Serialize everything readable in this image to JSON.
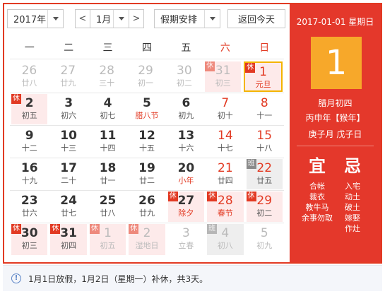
{
  "toolbar": {
    "year": "2017年",
    "prev_arrow": "<",
    "month": "1月",
    "next_arrow": ">",
    "holiday": "假期安排",
    "today": "返回今天"
  },
  "weekdays": [
    "一",
    "二",
    "三",
    "四",
    "五",
    "六",
    "日"
  ],
  "weeks": [
    [
      {
        "day": "26",
        "lunar": "廿八",
        "other": true
      },
      {
        "day": "27",
        "lunar": "廿九",
        "other": true
      },
      {
        "day": "28",
        "lunar": "三十",
        "other": true
      },
      {
        "day": "29",
        "lunar": "初一",
        "other": true
      },
      {
        "day": "30",
        "lunar": "初二",
        "other": true
      },
      {
        "day": "31",
        "lunar": "初三",
        "other": true,
        "badge": "休"
      },
      {
        "day": "1",
        "lunar": "元旦",
        "badge": "休",
        "festival": true,
        "selected": true
      }
    ],
    [
      {
        "day": "2",
        "lunar": "初五",
        "badge": "休"
      },
      {
        "day": "3",
        "lunar": "初六"
      },
      {
        "day": "4",
        "lunar": "初七"
      },
      {
        "day": "5",
        "lunar": "腊八节",
        "festival": true
      },
      {
        "day": "6",
        "lunar": "初九"
      },
      {
        "day": "7",
        "lunar": "初十"
      },
      {
        "day": "8",
        "lunar": "十一"
      }
    ],
    [
      {
        "day": "9",
        "lunar": "十二"
      },
      {
        "day": "10",
        "lunar": "十三"
      },
      {
        "day": "11",
        "lunar": "十四"
      },
      {
        "day": "12",
        "lunar": "十五"
      },
      {
        "day": "13",
        "lunar": "十六"
      },
      {
        "day": "14",
        "lunar": "十七"
      },
      {
        "day": "15",
        "lunar": "十八"
      }
    ],
    [
      {
        "day": "16",
        "lunar": "十九"
      },
      {
        "day": "17",
        "lunar": "二十"
      },
      {
        "day": "18",
        "lunar": "廿一"
      },
      {
        "day": "19",
        "lunar": "廿二"
      },
      {
        "day": "20",
        "lunar": "小年",
        "festival": true
      },
      {
        "day": "21",
        "lunar": "廿四"
      },
      {
        "day": "22",
        "lunar": "廿五",
        "badge": "班"
      }
    ],
    [
      {
        "day": "23",
        "lunar": "廿六"
      },
      {
        "day": "24",
        "lunar": "廿七"
      },
      {
        "day": "25",
        "lunar": "廿八"
      },
      {
        "day": "26",
        "lunar": "廿九"
      },
      {
        "day": "27",
        "lunar": "除夕",
        "badge": "休",
        "festival": true
      },
      {
        "day": "28",
        "lunar": "春节",
        "badge": "休",
        "festival": true
      },
      {
        "day": "29",
        "lunar": "初二",
        "badge": "休"
      }
    ],
    [
      {
        "day": "30",
        "lunar": "初三",
        "badge": "休"
      },
      {
        "day": "31",
        "lunar": "初四",
        "badge": "休"
      },
      {
        "day": "1",
        "lunar": "初五",
        "other": true,
        "badge": "休"
      },
      {
        "day": "2",
        "lunar": "湿地日",
        "other": true,
        "badge": "休"
      },
      {
        "day": "3",
        "lunar": "立春",
        "other": true
      },
      {
        "day": "4",
        "lunar": "初八",
        "other": true,
        "badge": "班"
      },
      {
        "day": "5",
        "lunar": "初九",
        "other": true
      }
    ]
  ],
  "side": {
    "date": "2017-01-01 星期日",
    "big_day": "1",
    "lunar_date": "腊月初四",
    "ganzhi_year": "丙申年【猴年】",
    "ganzhi_month_day": "庚子月 戊子日",
    "yi_label": "宜",
    "ji_label": "忌",
    "yi": [
      "合帐",
      "裁衣",
      "教牛马",
      "余事勿取"
    ],
    "ji": [
      "入宅",
      "动土",
      "破土",
      "嫁娶",
      "作灶"
    ]
  },
  "footer": {
    "icon": "info-icon",
    "info_glyph": "!",
    "note": "1月1日放假，1月2日（星期一）补休，共3天。"
  },
  "colors": {
    "accent": "#e23a23",
    "side_bg": "#e4382b",
    "highlight": "#f7a82a",
    "rest_bg": "#fdeaea",
    "work_badge": "#8a8a8a"
  }
}
